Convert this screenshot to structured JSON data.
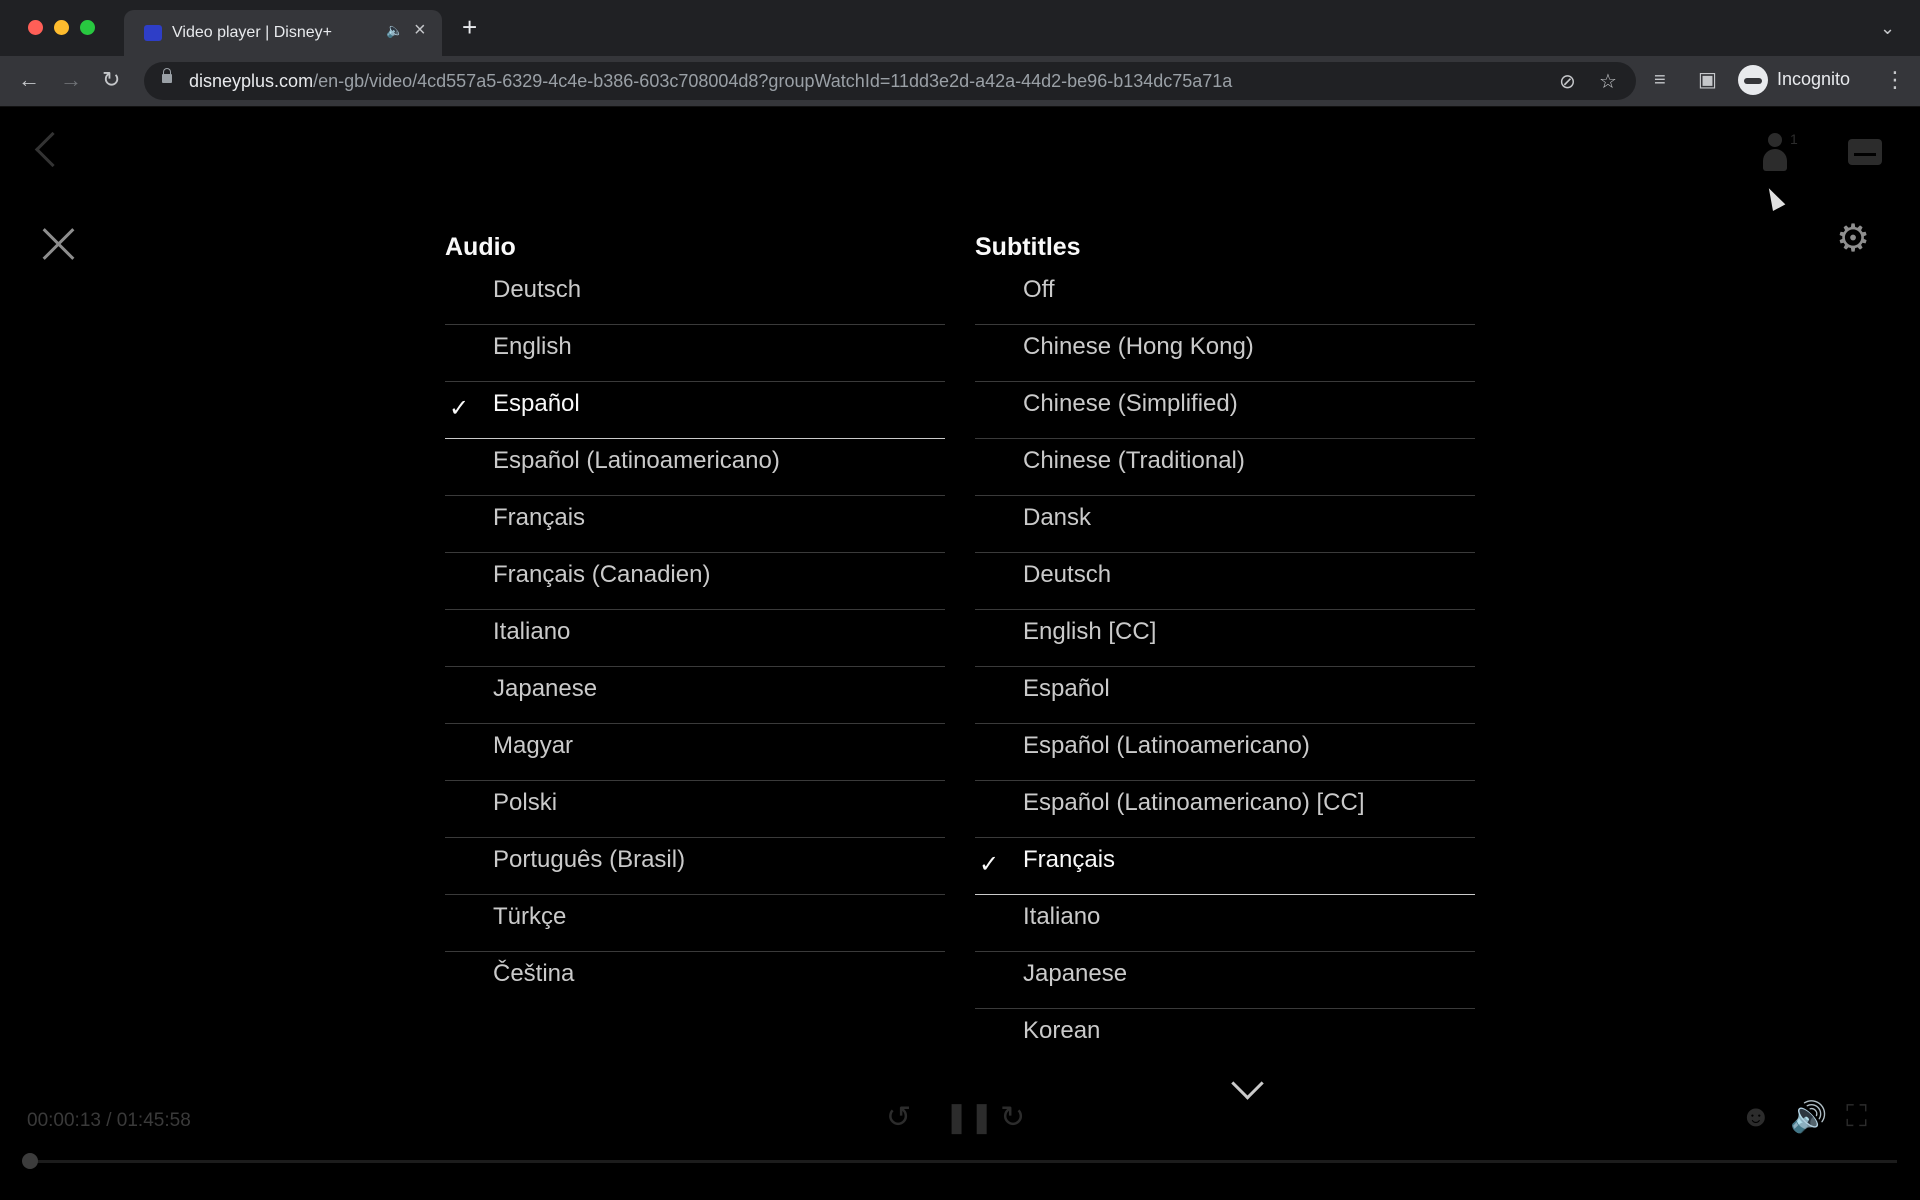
{
  "browser": {
    "tab_title": "Video player | Disney+",
    "url_host": "disneyplus.com",
    "url_path": "/en-gb/video/4cd557a5-6329-4c4e-b386-603c708004d8?groupWatchId=11dd3e2d-a42a-44d2-be96-b134dc75a71a",
    "profile_label": "Incognito"
  },
  "player": {
    "group_count": "1",
    "timecode": "00:00:13 / 01:45:58",
    "progress_fraction": 0.002
  },
  "audio": {
    "title": "Audio",
    "options": [
      {
        "label": "Deutsch",
        "selected": false
      },
      {
        "label": "English",
        "selected": false
      },
      {
        "label": "Español",
        "selected": true
      },
      {
        "label": "Español (Latinoamericano)",
        "selected": false
      },
      {
        "label": "Français",
        "selected": false
      },
      {
        "label": "Français (Canadien)",
        "selected": false
      },
      {
        "label": "Italiano",
        "selected": false
      },
      {
        "label": "Japanese",
        "selected": false
      },
      {
        "label": "Magyar",
        "selected": false
      },
      {
        "label": "Polski",
        "selected": false
      },
      {
        "label": "Português (Brasil)",
        "selected": false
      },
      {
        "label": "Türkçe",
        "selected": false
      },
      {
        "label": "Čeština",
        "selected": false
      }
    ]
  },
  "subtitles": {
    "title": "Subtitles",
    "options": [
      {
        "label": "Off",
        "selected": false
      },
      {
        "label": "Chinese (Hong Kong)",
        "selected": false
      },
      {
        "label": "Chinese (Simplified)",
        "selected": false
      },
      {
        "label": "Chinese (Traditional)",
        "selected": false
      },
      {
        "label": "Dansk",
        "selected": false
      },
      {
        "label": "Deutsch",
        "selected": false
      },
      {
        "label": "English [CC]",
        "selected": false
      },
      {
        "label": "Español",
        "selected": false
      },
      {
        "label": "Español (Latinoamericano)",
        "selected": false
      },
      {
        "label": "Español (Latinoamericano) [CC]",
        "selected": false
      },
      {
        "label": "Français",
        "selected": true
      },
      {
        "label": "Italiano",
        "selected": false
      },
      {
        "label": "Japanese",
        "selected": false
      },
      {
        "label": "Korean",
        "selected": false
      }
    ]
  },
  "icons": {
    "check": "✓",
    "gear": "⚙"
  }
}
